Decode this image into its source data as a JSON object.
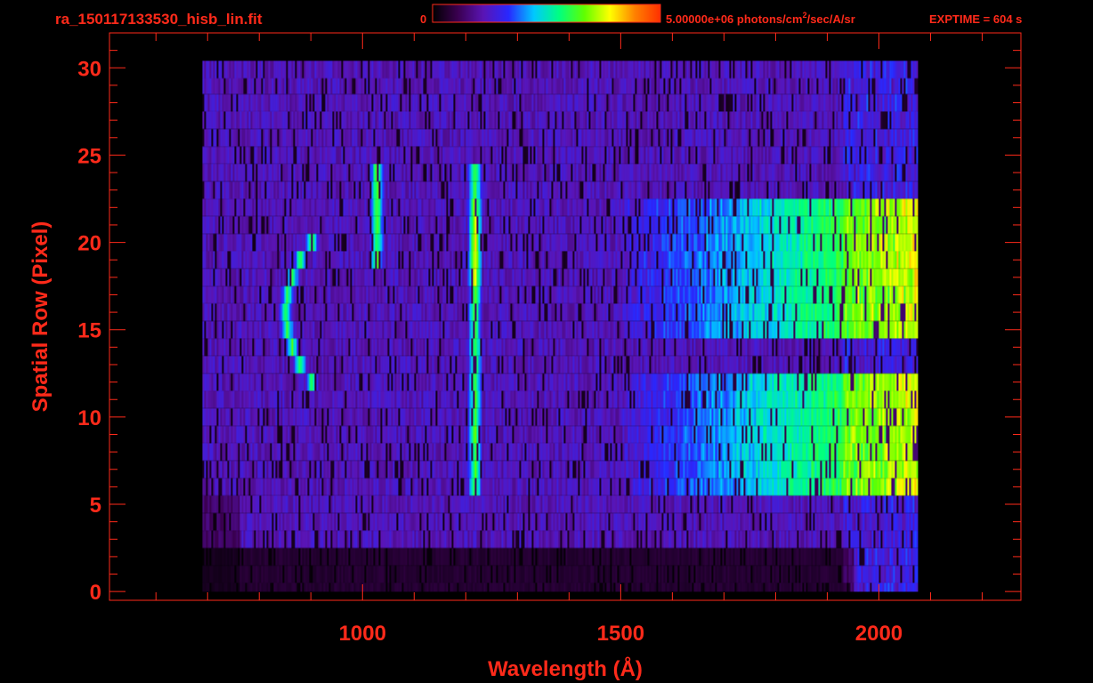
{
  "header": {
    "filename": "ra_150117133530_hisb_lin.fit",
    "colorbar_min": "0",
    "colorbar_max_prefix": "5.00000e+06 photons/cm",
    "colorbar_max_sup": "2",
    "colorbar_max_suffix": "/sec/A/sr",
    "exptime": "EXPTIME = 604 s"
  },
  "colors": {
    "axis": "#ff2a1a",
    "background": "#000000",
    "colormap": [
      "#000000",
      "#3a0050",
      "#5a14b4",
      "#2828ff",
      "#00c8ff",
      "#00ff80",
      "#60ff00",
      "#ffff00",
      "#ff8000",
      "#ff3000"
    ]
  },
  "chart_data": {
    "type": "heatmap",
    "xlabel": "Wavelength (Å)",
    "ylabel": "Spatial Row (Pixel)",
    "xlim": [
      510,
      2275
    ],
    "ylim": [
      -0.5,
      32
    ],
    "xticks": [
      1000,
      1500,
      2000
    ],
    "xtick_labels": [
      "1000",
      "1500",
      "2000"
    ],
    "yticks": [
      0,
      5,
      10,
      15,
      20,
      25,
      30
    ],
    "ytick_labels": [
      "0",
      "5",
      "10",
      "15",
      "20",
      "25",
      "30"
    ],
    "colorbar_range": [
      0,
      5000000
    ],
    "colorbar_units": "photons/cm^2/sec/A/sr",
    "data_x_range": [
      690,
      2075
    ],
    "data_y_range": [
      0,
      30
    ],
    "features": [
      {
        "type": "emission_line",
        "wavelength": 1216,
        "rows": [
          6,
          24
        ],
        "peak_rows": [
          18,
          22
        ]
      },
      {
        "type": "emission_line",
        "wavelength": 1026,
        "rows": [
          19,
          24
        ]
      },
      {
        "type": "arc",
        "wavelength_range": [
          850,
          900
        ],
        "rows": [
          12,
          20
        ]
      },
      {
        "type": "continuum_band",
        "wavelength_range": [
          1500,
          2070
        ],
        "rows": [
          15,
          22
        ]
      },
      {
        "type": "continuum_band",
        "wavelength_range": [
          1500,
          2070
        ],
        "rows": [
          6,
          12
        ]
      }
    ]
  }
}
